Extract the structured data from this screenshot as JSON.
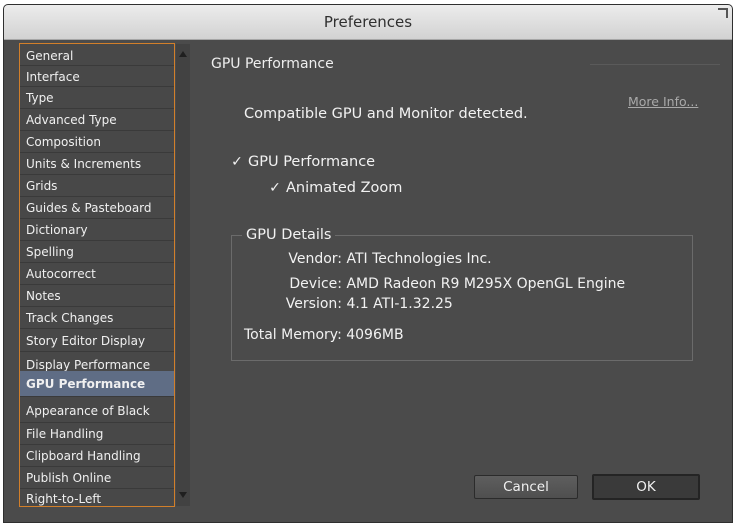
{
  "window": {
    "title": "Preferences"
  },
  "sidebar": {
    "items": [
      {
        "label": "General"
      },
      {
        "label": "Interface"
      },
      {
        "label": "Type"
      },
      {
        "label": "Advanced Type"
      },
      {
        "label": "Composition"
      },
      {
        "label": "Units & Increments"
      },
      {
        "label": "Grids"
      },
      {
        "label": "Guides & Pasteboard"
      },
      {
        "label": "Dictionary"
      },
      {
        "label": "Spelling"
      },
      {
        "label": "Autocorrect"
      },
      {
        "label": "Notes"
      },
      {
        "label": "Track Changes"
      },
      {
        "label": "Story Editor Display"
      },
      {
        "label": "Display Performance"
      },
      {
        "label": "GPU Performance",
        "selected": true
      },
      {
        "label": "Appearance of Black"
      },
      {
        "label": "File Handling"
      },
      {
        "label": "Clipboard Handling"
      },
      {
        "label": "Publish Online"
      },
      {
        "label": "Right-to-Left"
      }
    ]
  },
  "main": {
    "section_title": "GPU Performance",
    "more_info": "More Info...",
    "detected_text": "Compatible GPU and Monitor detected.",
    "gpu_performance": {
      "label": "GPU Performance",
      "checked": true
    },
    "animated_zoom": {
      "label": "Animated Zoom",
      "checked": true
    },
    "details": {
      "legend": "GPU Details",
      "vendor_label": "Vendor:",
      "vendor_value": "ATI Technologies Inc.",
      "device_label": "Device:",
      "device_value": "AMD Radeon R9 M295X OpenGL Engine",
      "version_label": "Version:",
      "version_value": "4.1 ATI-1.32.25",
      "memory_label": "Total Memory:",
      "memory_value": "4096MB"
    }
  },
  "buttons": {
    "cancel": "Cancel",
    "ok": "OK"
  },
  "colors": {
    "panel_bg": "#4b4b4b",
    "sidebar_border": "#d27f2a",
    "selected_bg": "#5f6d85"
  }
}
